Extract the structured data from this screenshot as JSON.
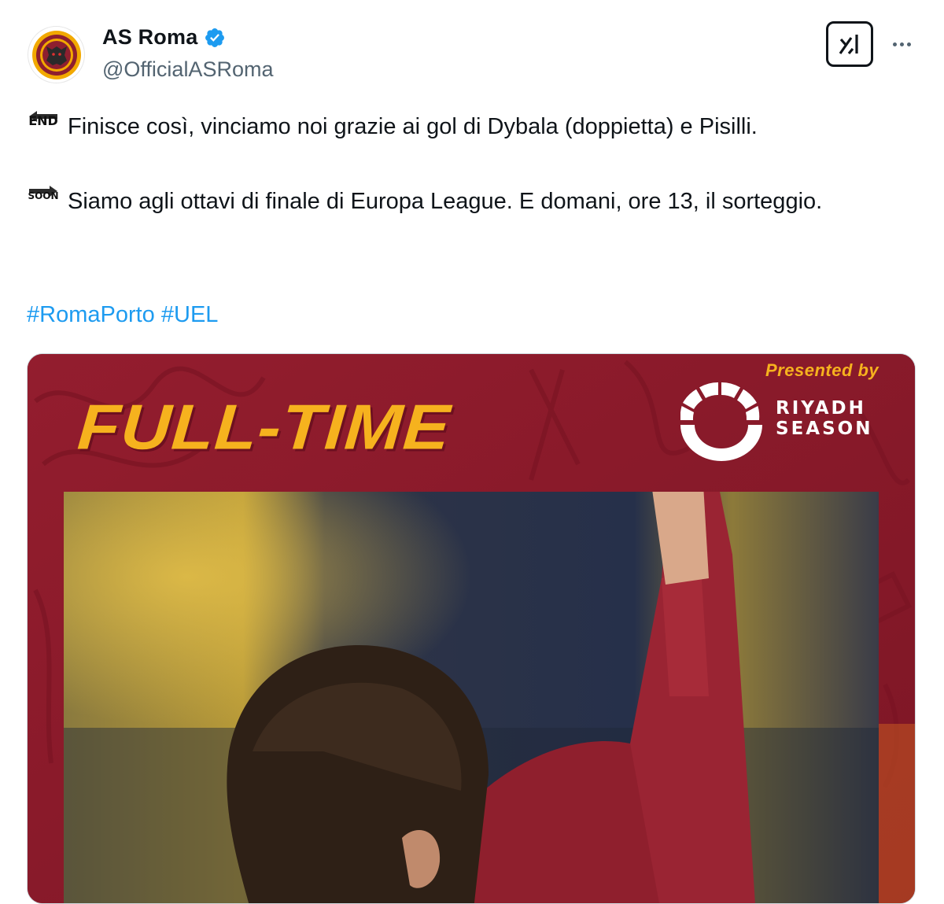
{
  "account": {
    "display_name": "AS Roma",
    "handle": "@OfficialASRoma",
    "verified": true,
    "avatar_icon": "as-roma-crest-icon"
  },
  "header_actions": {
    "grok_icon": "grok-icon",
    "more_icon": "more-dots-icon"
  },
  "tweet": {
    "paragraphs": [
      {
        "emoji": "end-arrow-emoji",
        "emoji_word": "END",
        "text": "Finisce così, vinciamo noi grazie ai gol di Dybala (doppietta) e Pisilli."
      },
      {
        "emoji": "soon-arrow-emoji",
        "emoji_word": "SOON",
        "text": "Siamo agli ottavi di finale di Europa League. E domani, ore 13, il sorteggio."
      }
    ],
    "hashtags": [
      "#RomaPorto",
      "#UEL"
    ]
  },
  "media": {
    "headline": "FULL-TIME",
    "presented_by": "Presented by",
    "sponsor_line1": "RIYADH",
    "sponsor_line2": "SEASON",
    "colors": {
      "background": "#8d1b2b",
      "headline": "#f6b21e",
      "link": "#1d9bf0",
      "verified": "#1d9bf0"
    }
  }
}
